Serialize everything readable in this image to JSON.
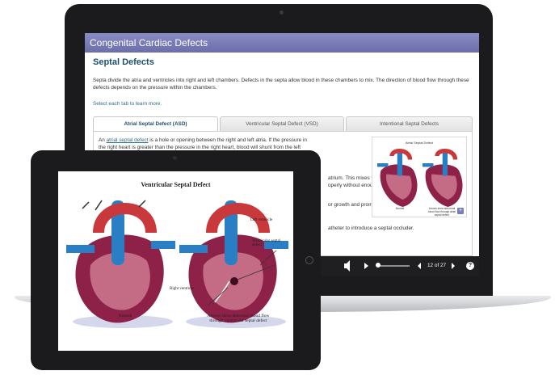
{
  "laptop": {
    "course_title": "Congenital Cardiac Defects",
    "page_title": "Septal Defects",
    "intro": "Septa divide the atria and ventricles into right and left chambers. Defects in the septa allow blood in these chambers to mix. The direction of blood flow through these defects depends on the pressure within the chambers.",
    "instruction": "Select each tab to learn more.",
    "tabs": [
      {
        "label": "Atrial Septal Defect (ASD)",
        "active": true
      },
      {
        "label": "Ventricular Septal Defect (VSD)",
        "active": false
      },
      {
        "label": "Intentional Septal Defects",
        "active": false
      }
    ],
    "panel": {
      "lead": "An",
      "term": "atrial septal defect",
      "text": "is a hole or opening between the right and left atria. If the pressure in the right heart is greater than the pressure in the right heart, blood will shunt from the left atrium to the right atrium. This increases blood flow through the lungs and decreases blood flow to the body. The organs",
      "line_1": "atrium. This mixes venous",
      "line_2": "operly without enough",
      "line_3": "or growth and promote",
      "line_4": "atheter to introduce a septal occluder."
    },
    "thumbnail": {
      "title": "Atrial Septal Defect",
      "caption_left": "Normal",
      "caption_right": "Arrows show abnormal blood flow through atrial septal defect",
      "expand_icon": "plus-icon"
    },
    "player": {
      "page_indicator": "12 of 27",
      "help": "?"
    }
  },
  "tablet": {
    "title": "Ventricular Septal Defect",
    "label_left_ventricle": "Left ventricle",
    "label_vsd": "Ventricular septal defect",
    "label_right_ventricle": "Right ventricle",
    "caption_left": "Normal",
    "caption_right": "Arrows show abnormal blood flow through ventricular septal defect"
  },
  "colors": {
    "header": "#7577b5",
    "heading": "#1e4f6a",
    "link": "#2f6e87",
    "heart_muscle": "#8e2148",
    "vein": "#2a7fc4",
    "artery": "#c9383b"
  }
}
